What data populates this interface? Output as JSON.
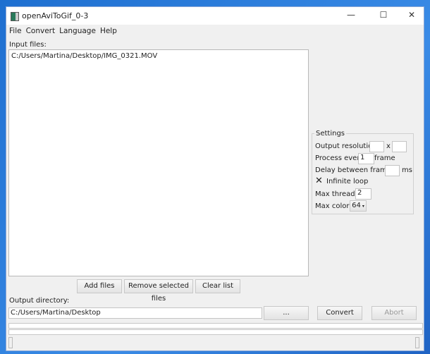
{
  "window": {
    "title": "openAviToGif_0-3",
    "minimize": "—",
    "maximize": "☐",
    "close": "✕"
  },
  "menu": [
    "File",
    "Convert",
    "Language",
    "Help"
  ],
  "input_label": "Input files:",
  "files": [
    "C:/Users/Martina/Desktop/IMG_0321.MOV"
  ],
  "buttons": {
    "add": "Add files",
    "remove": "Remove selected files",
    "clear": "Clear list",
    "browse": "...",
    "convert": "Convert",
    "abort": "Abort"
  },
  "output_label": "Output directory:",
  "output_dir": "C:/Users/Martina/Desktop",
  "settings": {
    "title": "Settings",
    "resolution_label": "Output resolution:",
    "x": "x",
    "width": "",
    "height": "",
    "process_label": "Process every",
    "process_value": "1",
    "frame": "frame",
    "delay_label": "Delay between frames:",
    "delay_value": "",
    "ms": "ms",
    "loop_label": "Infinite loop",
    "loop_checked": true,
    "threads_label": "Max threads:",
    "threads_value": "2",
    "colors_label": "Max colors:",
    "colors_value": "64"
  },
  "progress": [
    0,
    0
  ]
}
